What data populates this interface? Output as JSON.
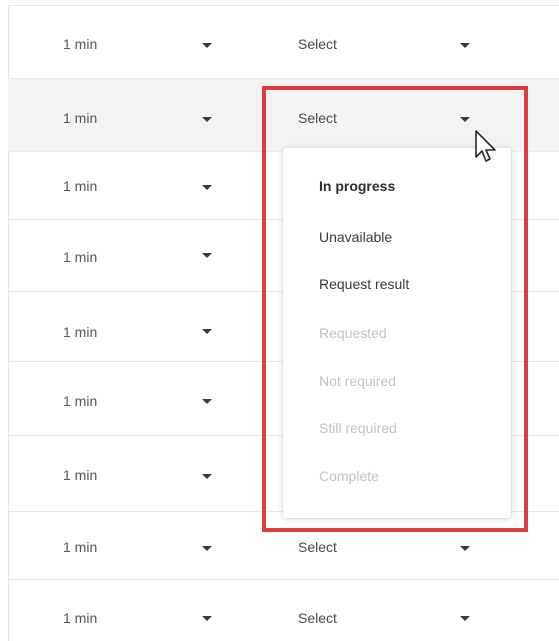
{
  "table": {
    "rows": [
      {
        "duration": "1 min",
        "status": "Select"
      },
      {
        "duration": "1 min",
        "status": "Select"
      },
      {
        "duration": "1 min",
        "status": ""
      },
      {
        "duration": "1 min",
        "status": ""
      },
      {
        "duration": "1 min",
        "status": ""
      },
      {
        "duration": "1 min",
        "status": ""
      },
      {
        "duration": "1 min",
        "status": ""
      },
      {
        "duration": "1 min",
        "status": "Select"
      },
      {
        "duration": "1 min",
        "status": "Select"
      }
    ]
  },
  "status_menu": {
    "items": [
      {
        "label": "In progress",
        "state": "selected"
      },
      {
        "label": "Unavailable",
        "state": "enabled"
      },
      {
        "label": "Request result",
        "state": "enabled"
      },
      {
        "label": "Requested",
        "state": "disabled"
      },
      {
        "label": "Not required",
        "state": "disabled"
      },
      {
        "label": "Still required",
        "state": "disabled"
      },
      {
        "label": "Complete",
        "state": "disabled"
      }
    ]
  },
  "colors": {
    "highlight_border": "#e03c3c",
    "row_hover": "#f3f3f3",
    "disabled_text": "#c2c2c2"
  },
  "icons": {
    "dropdown": "caret-down-icon",
    "pointer": "mouse-pointer-icon"
  }
}
